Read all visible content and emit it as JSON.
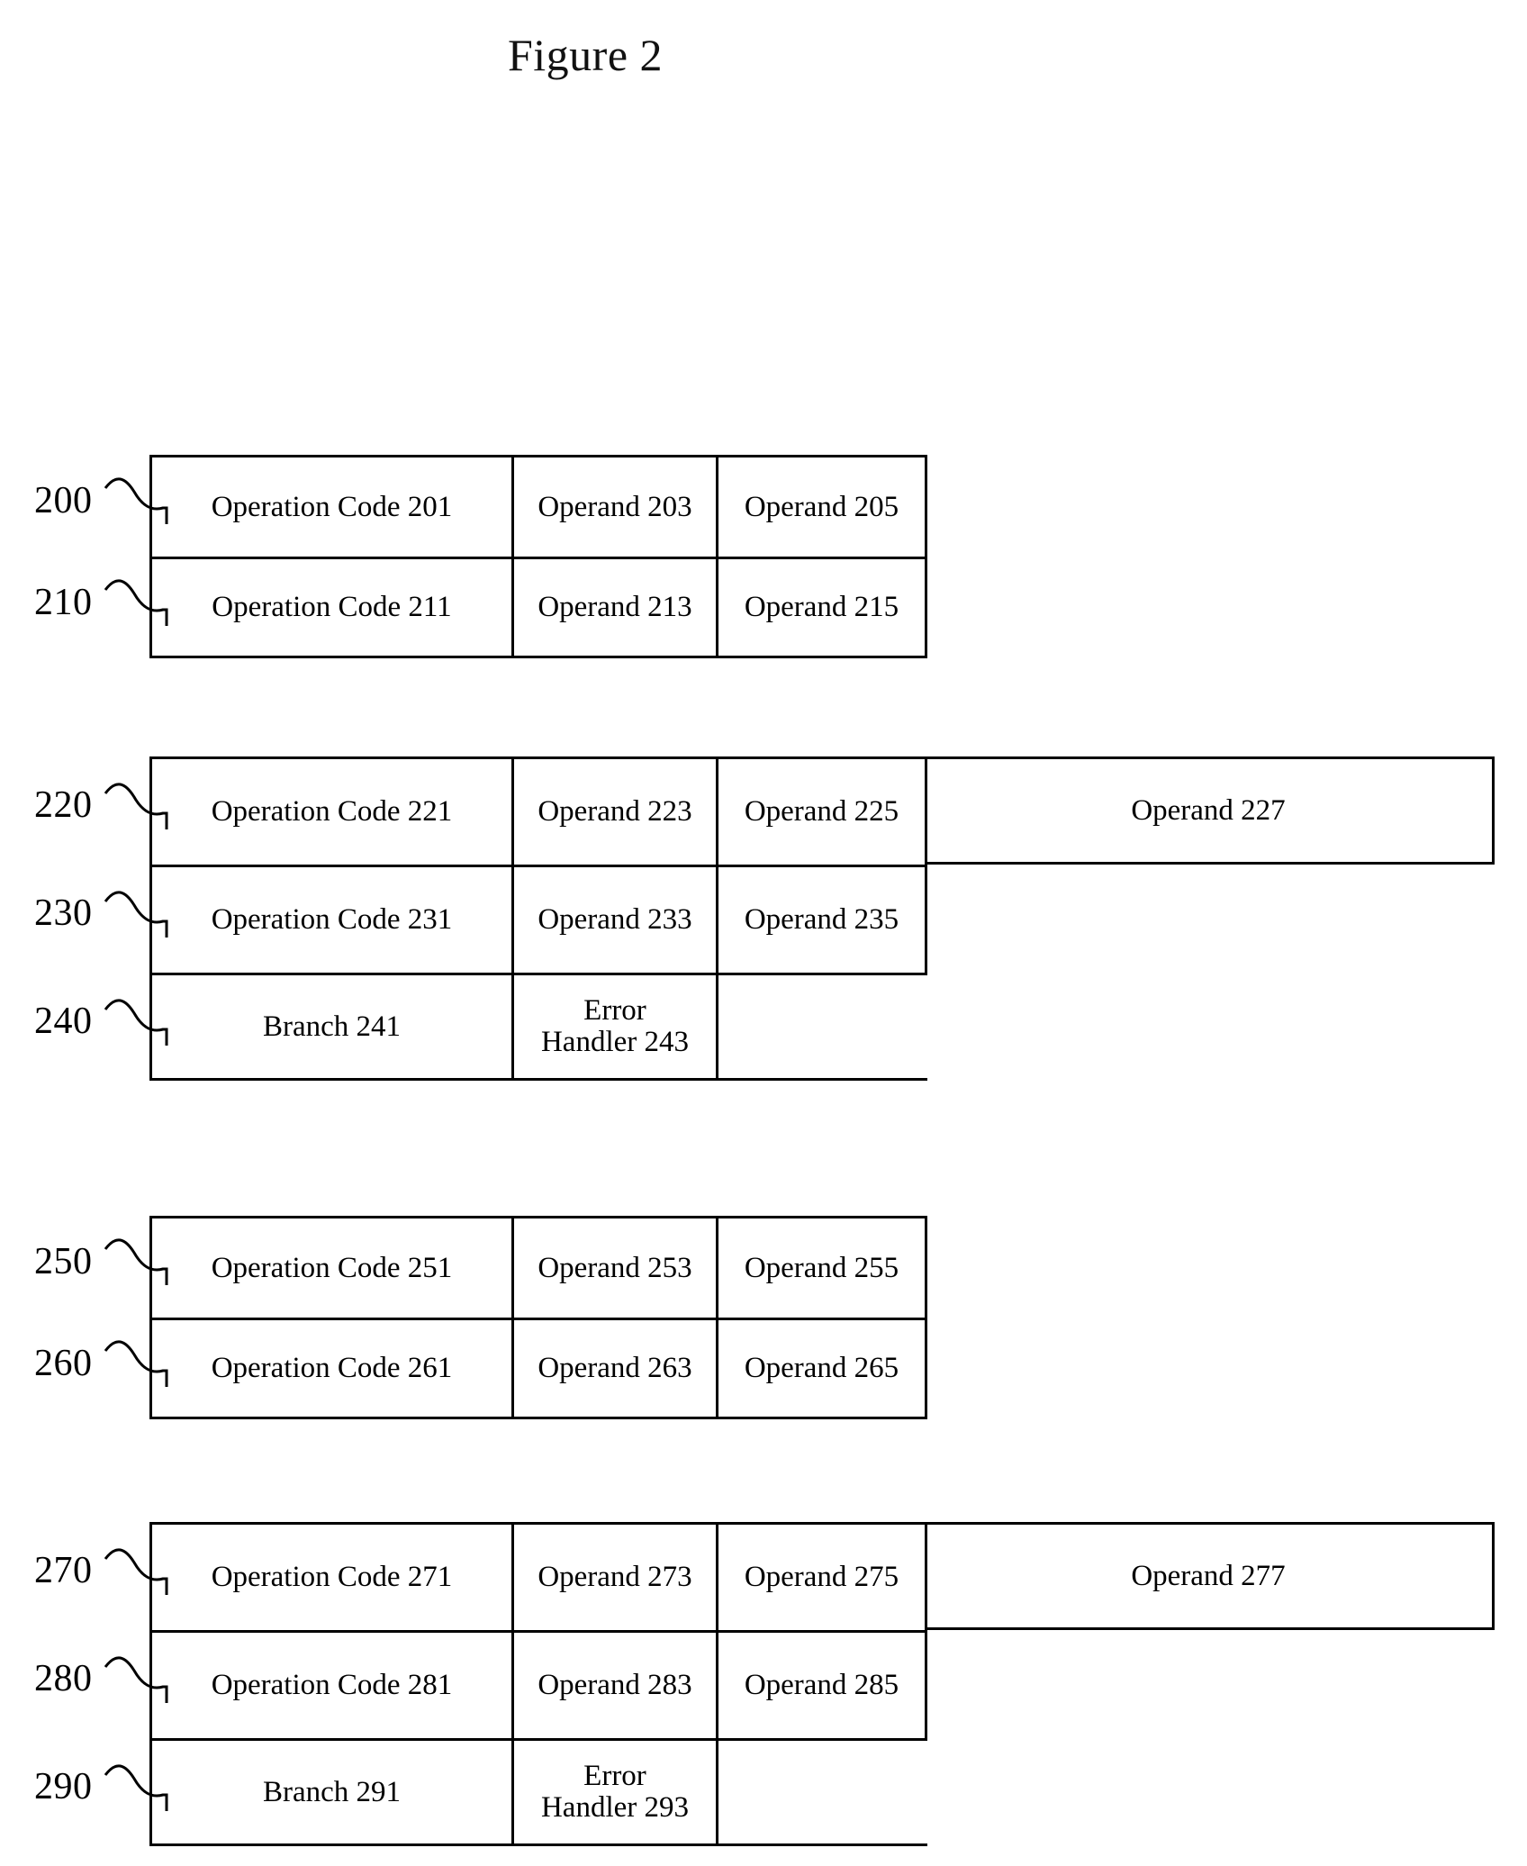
{
  "figure": {
    "title": "Figure 2"
  },
  "blocks": [
    {
      "id": "block-200",
      "rows": [
        {
          "ref": "200",
          "cells": [
            "Operation Code 201",
            "Operand 203",
            "Operand 205"
          ]
        },
        {
          "ref": "210",
          "cells": [
            "Operation Code 211",
            "Operand 213",
            "Operand 215"
          ]
        }
      ]
    },
    {
      "id": "block-220",
      "rows": [
        {
          "ref": "220",
          "cells": [
            "Operation Code 221",
            "Operand 223",
            "Operand 225"
          ],
          "extension": "Operand 227"
        },
        {
          "ref": "230",
          "cells": [
            "Operation Code 231",
            "Operand 233",
            "Operand 235"
          ]
        },
        {
          "ref": "240",
          "cells": [
            "Branch 241",
            "Error\nHandler 243"
          ]
        }
      ]
    },
    {
      "id": "block-250",
      "rows": [
        {
          "ref": "250",
          "cells": [
            "Operation Code 251",
            "Operand 253",
            "Operand 255"
          ]
        },
        {
          "ref": "260",
          "cells": [
            "Operation Code 261",
            "Operand 263",
            "Operand 265"
          ]
        }
      ]
    },
    {
      "id": "block-270",
      "rows": [
        {
          "ref": "270",
          "cells": [
            "Operation Code 271",
            "Operand 273",
            "Operand 275"
          ],
          "extension": "Operand 277"
        },
        {
          "ref": "280",
          "cells": [
            "Operation Code 281",
            "Operand 283",
            "Operand 285"
          ]
        },
        {
          "ref": "290",
          "cells": [
            "Branch 291",
            "Error\nHandler 293"
          ]
        }
      ]
    }
  ]
}
